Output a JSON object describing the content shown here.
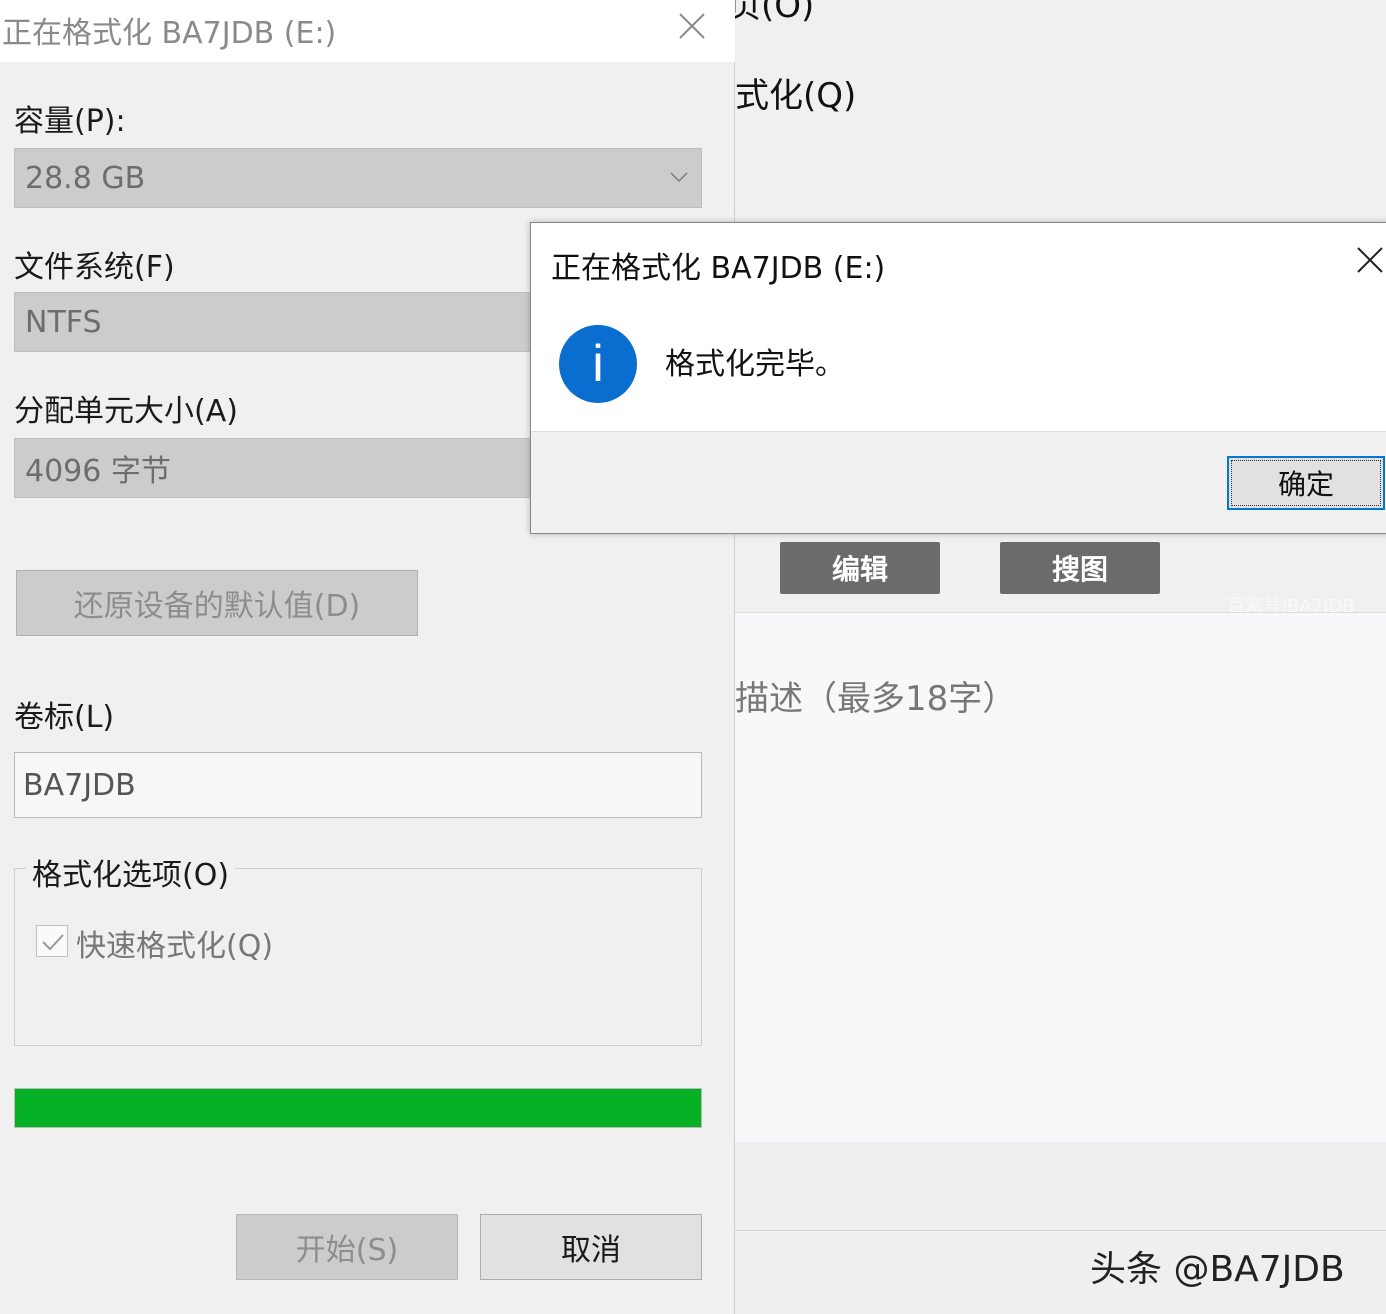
{
  "background": {
    "partial_menu_top": "页(O)",
    "partial_menu_format": "式化(Q)",
    "edit_button": "编辑",
    "search_image_button": "搜图",
    "faint_watermark": "百家号/BA7JDB",
    "description_placeholder": "描述（最多18字）",
    "credit": "头条 @BA7JDB"
  },
  "format_dialog": {
    "title": "正在格式化 BA7JDB (E:)",
    "capacity_label": "容量(P):",
    "capacity_value": "28.8 GB",
    "filesystem_label": "文件系统(F)",
    "filesystem_value": "NTFS",
    "allocation_label": "分配单元大小(A)",
    "allocation_value": "4096 字节",
    "restore_defaults_button": "还原设备的默认值(D)",
    "volume_label": "卷标(L)",
    "volume_value": "BA7JDB",
    "options_group_label": "格式化选项(O)",
    "quick_format_label": "快速格式化(Q)",
    "quick_format_checked": true,
    "progress_percent": 100,
    "progress_color": "#06b025",
    "start_button": "开始(S)",
    "cancel_button": "取消"
  },
  "message_box": {
    "title": "正在格式化 BA7JDB (E:)",
    "icon": "info-icon",
    "message": "格式化完毕。",
    "ok_button": "确定",
    "icon_color": "#0a6ed1"
  }
}
